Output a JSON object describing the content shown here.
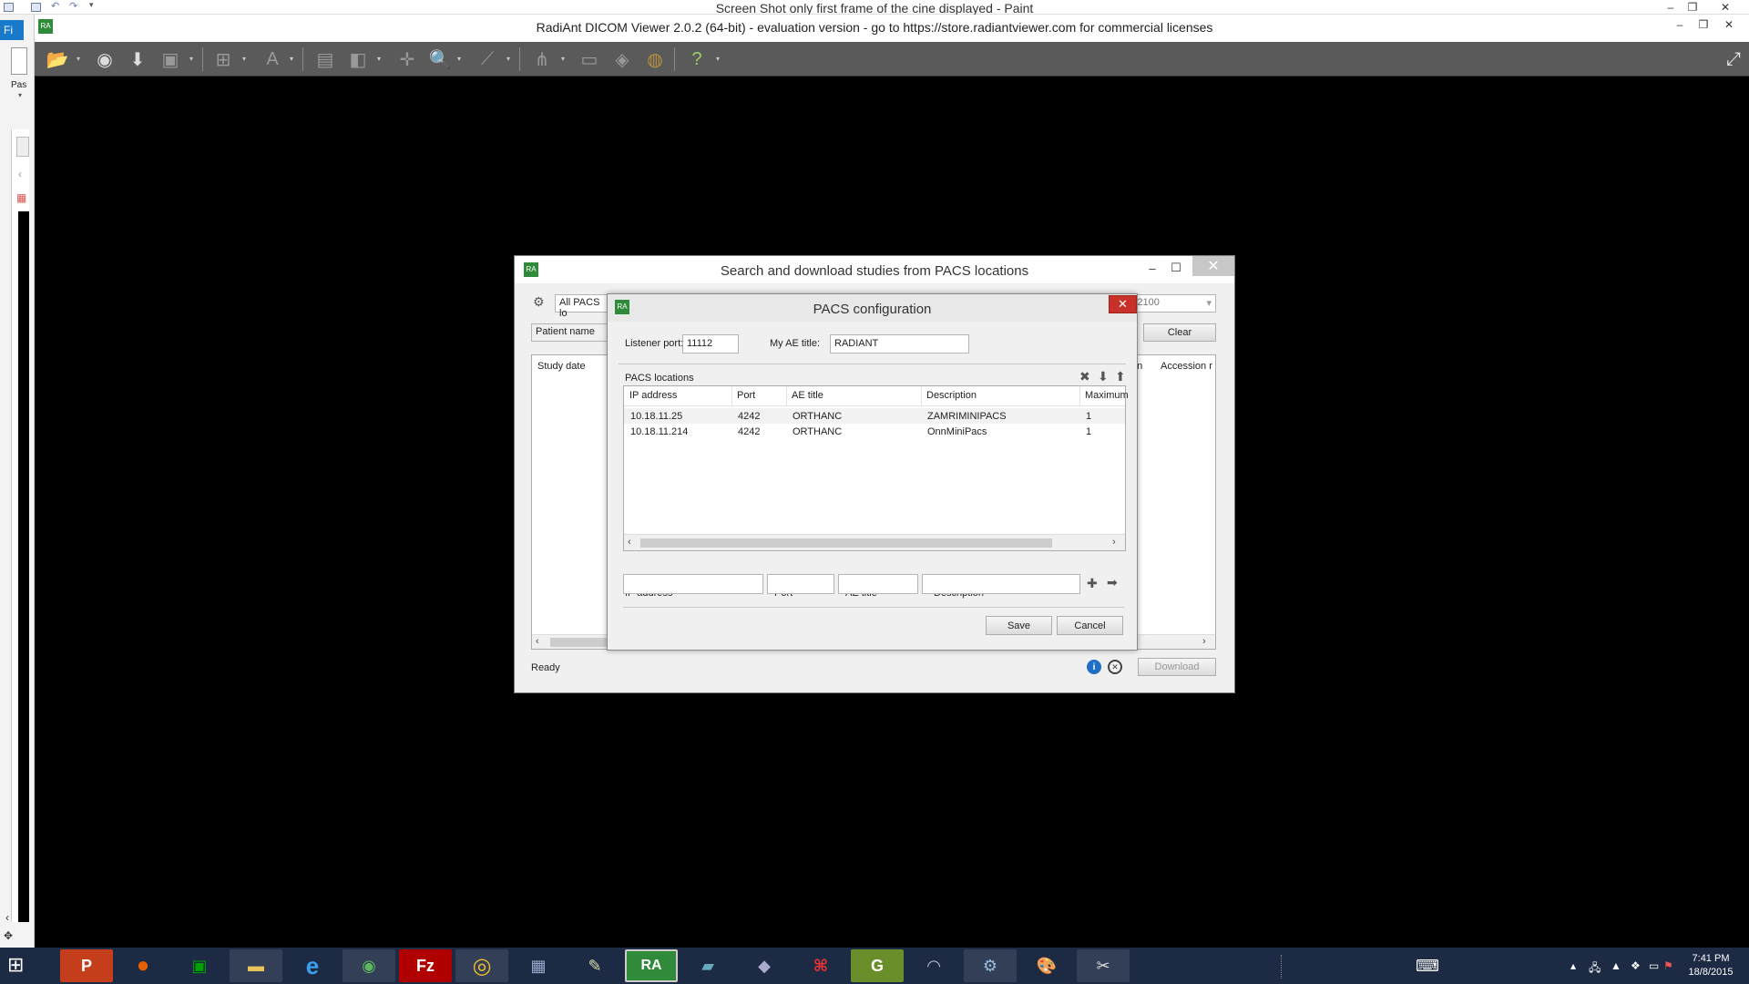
{
  "paint": {
    "title": "Screen Shot only first frame of the cine displayed - Paint",
    "file_tab": "Fi",
    "paste_label": "Pas"
  },
  "radiant": {
    "title": "RadiAnt DICOM Viewer 2.0.2 (64-bit) - evaluation version - go to https://store.radiantviewer.com for commercial licenses"
  },
  "search_dialog": {
    "title": "Search and download studies from PACS locations",
    "location_select": "All PACS lo",
    "date_to": "/12/2100",
    "patient_name_label": "Patient name",
    "clear_button": "Clear",
    "columns": {
      "study_date": "Study date",
      "partial_col": "on",
      "accession": "Accession r"
    },
    "status": "Ready",
    "download_button": "Download"
  },
  "pacs_dialog": {
    "title": "PACS configuration",
    "listener_port_label": "Listener port:",
    "listener_port": "11112",
    "ae_title_label": "My AE title:",
    "ae_title": "RADIANT",
    "locations_label": "PACS locations",
    "columns": [
      "IP address",
      "Port",
      "AE title",
      "Description",
      "Maximum"
    ],
    "rows": [
      {
        "ip": "10.18.11.25",
        "port": "4242",
        "ae": "ORTHANC",
        "desc": "ZAMRIMINIPACS",
        "max": "1"
      },
      {
        "ip": "10.18.11.214",
        "port": "4242",
        "ae": "ORTHANC",
        "desc": "OnnMiniPacs",
        "max": "1"
      }
    ],
    "form": {
      "ip_label": "IP address",
      "port_label": "Port",
      "ae_label": "AE title",
      "desc_label": "Description",
      "ip_value": "",
      "port_value": "",
      "ae_value": "",
      "desc_value": ""
    },
    "save_button": "Save",
    "cancel_button": "Cancel"
  },
  "taskbar": {
    "apps": [
      "P",
      "firefox",
      "store",
      "explorer",
      "e",
      "evernote",
      "Fz",
      "chrome",
      "network",
      "writer",
      "RA",
      "storage",
      "tablet",
      "acrobat",
      "G",
      "curl",
      "settings",
      "paint",
      "snip"
    ],
    "time": "7:41 PM",
    "date": "18/8/2015"
  },
  "colors": {
    "toolbar": "#5a5a5a",
    "taskbar": "#1c2a44",
    "close_red": "#c8302a",
    "file_tab_blue": "#1979ca"
  }
}
